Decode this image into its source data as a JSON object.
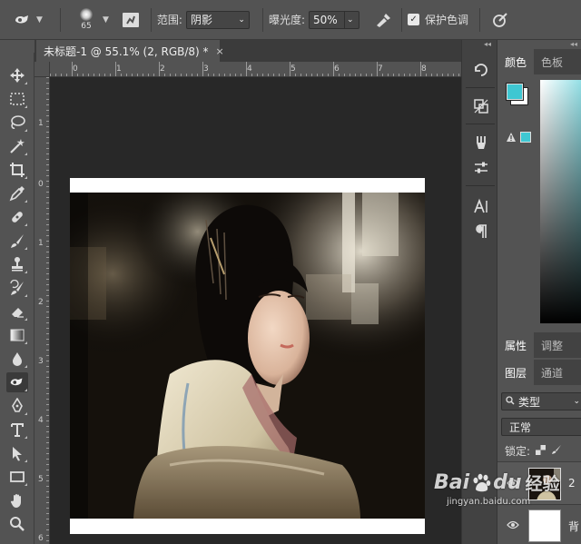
{
  "options_bar": {
    "brush_size": "65",
    "range_label": "范围:",
    "range_value": "阴影",
    "exposure_label": "曝光度:",
    "exposure_value": "50%",
    "protect_tones_label": "保护色调",
    "protect_tones_checked": true
  },
  "document_tab": {
    "title": "未标题-1 @ 55.1% (2, RGB/8) *",
    "close": "×"
  },
  "ruler": {
    "horizontal": [
      "0",
      "1",
      "2",
      "3",
      "4",
      "5",
      "6",
      "7",
      "8"
    ],
    "vertical": [
      "1",
      "0",
      "1",
      "2",
      "3",
      "4",
      "5",
      "6"
    ]
  },
  "panels": {
    "color_tabs": [
      "颜色",
      "色板"
    ],
    "foreground_color": "#3fc7d2",
    "background_color": "#ffffff",
    "properties_tabs": [
      "属性",
      "调整"
    ],
    "layers_tabs": [
      "图层",
      "通道"
    ],
    "filter_kind": "类型",
    "blend_mode": "正常",
    "lock_label": "锁定:",
    "layers": [
      {
        "name": "2"
      },
      {
        "name": "背"
      }
    ]
  },
  "watermark": {
    "brand_a": "Bai",
    "brand_b": "du",
    "suffix": "经验",
    "url": "jingyan.baidu.com"
  },
  "icons": {
    "toolbar": [
      "move-icon",
      "marquee-icon",
      "lasso-icon",
      "magic-wand-icon",
      "crop-icon",
      "eyedropper-icon",
      "healing-brush-icon",
      "brush-icon",
      "clone-stamp-icon",
      "history-brush-icon",
      "eraser-icon",
      "gradient-icon",
      "blur-icon",
      "burn-icon",
      "pen-icon",
      "type-icon",
      "path-select-icon",
      "rectangle-icon",
      "hand-icon",
      "zoom-icon"
    ]
  }
}
